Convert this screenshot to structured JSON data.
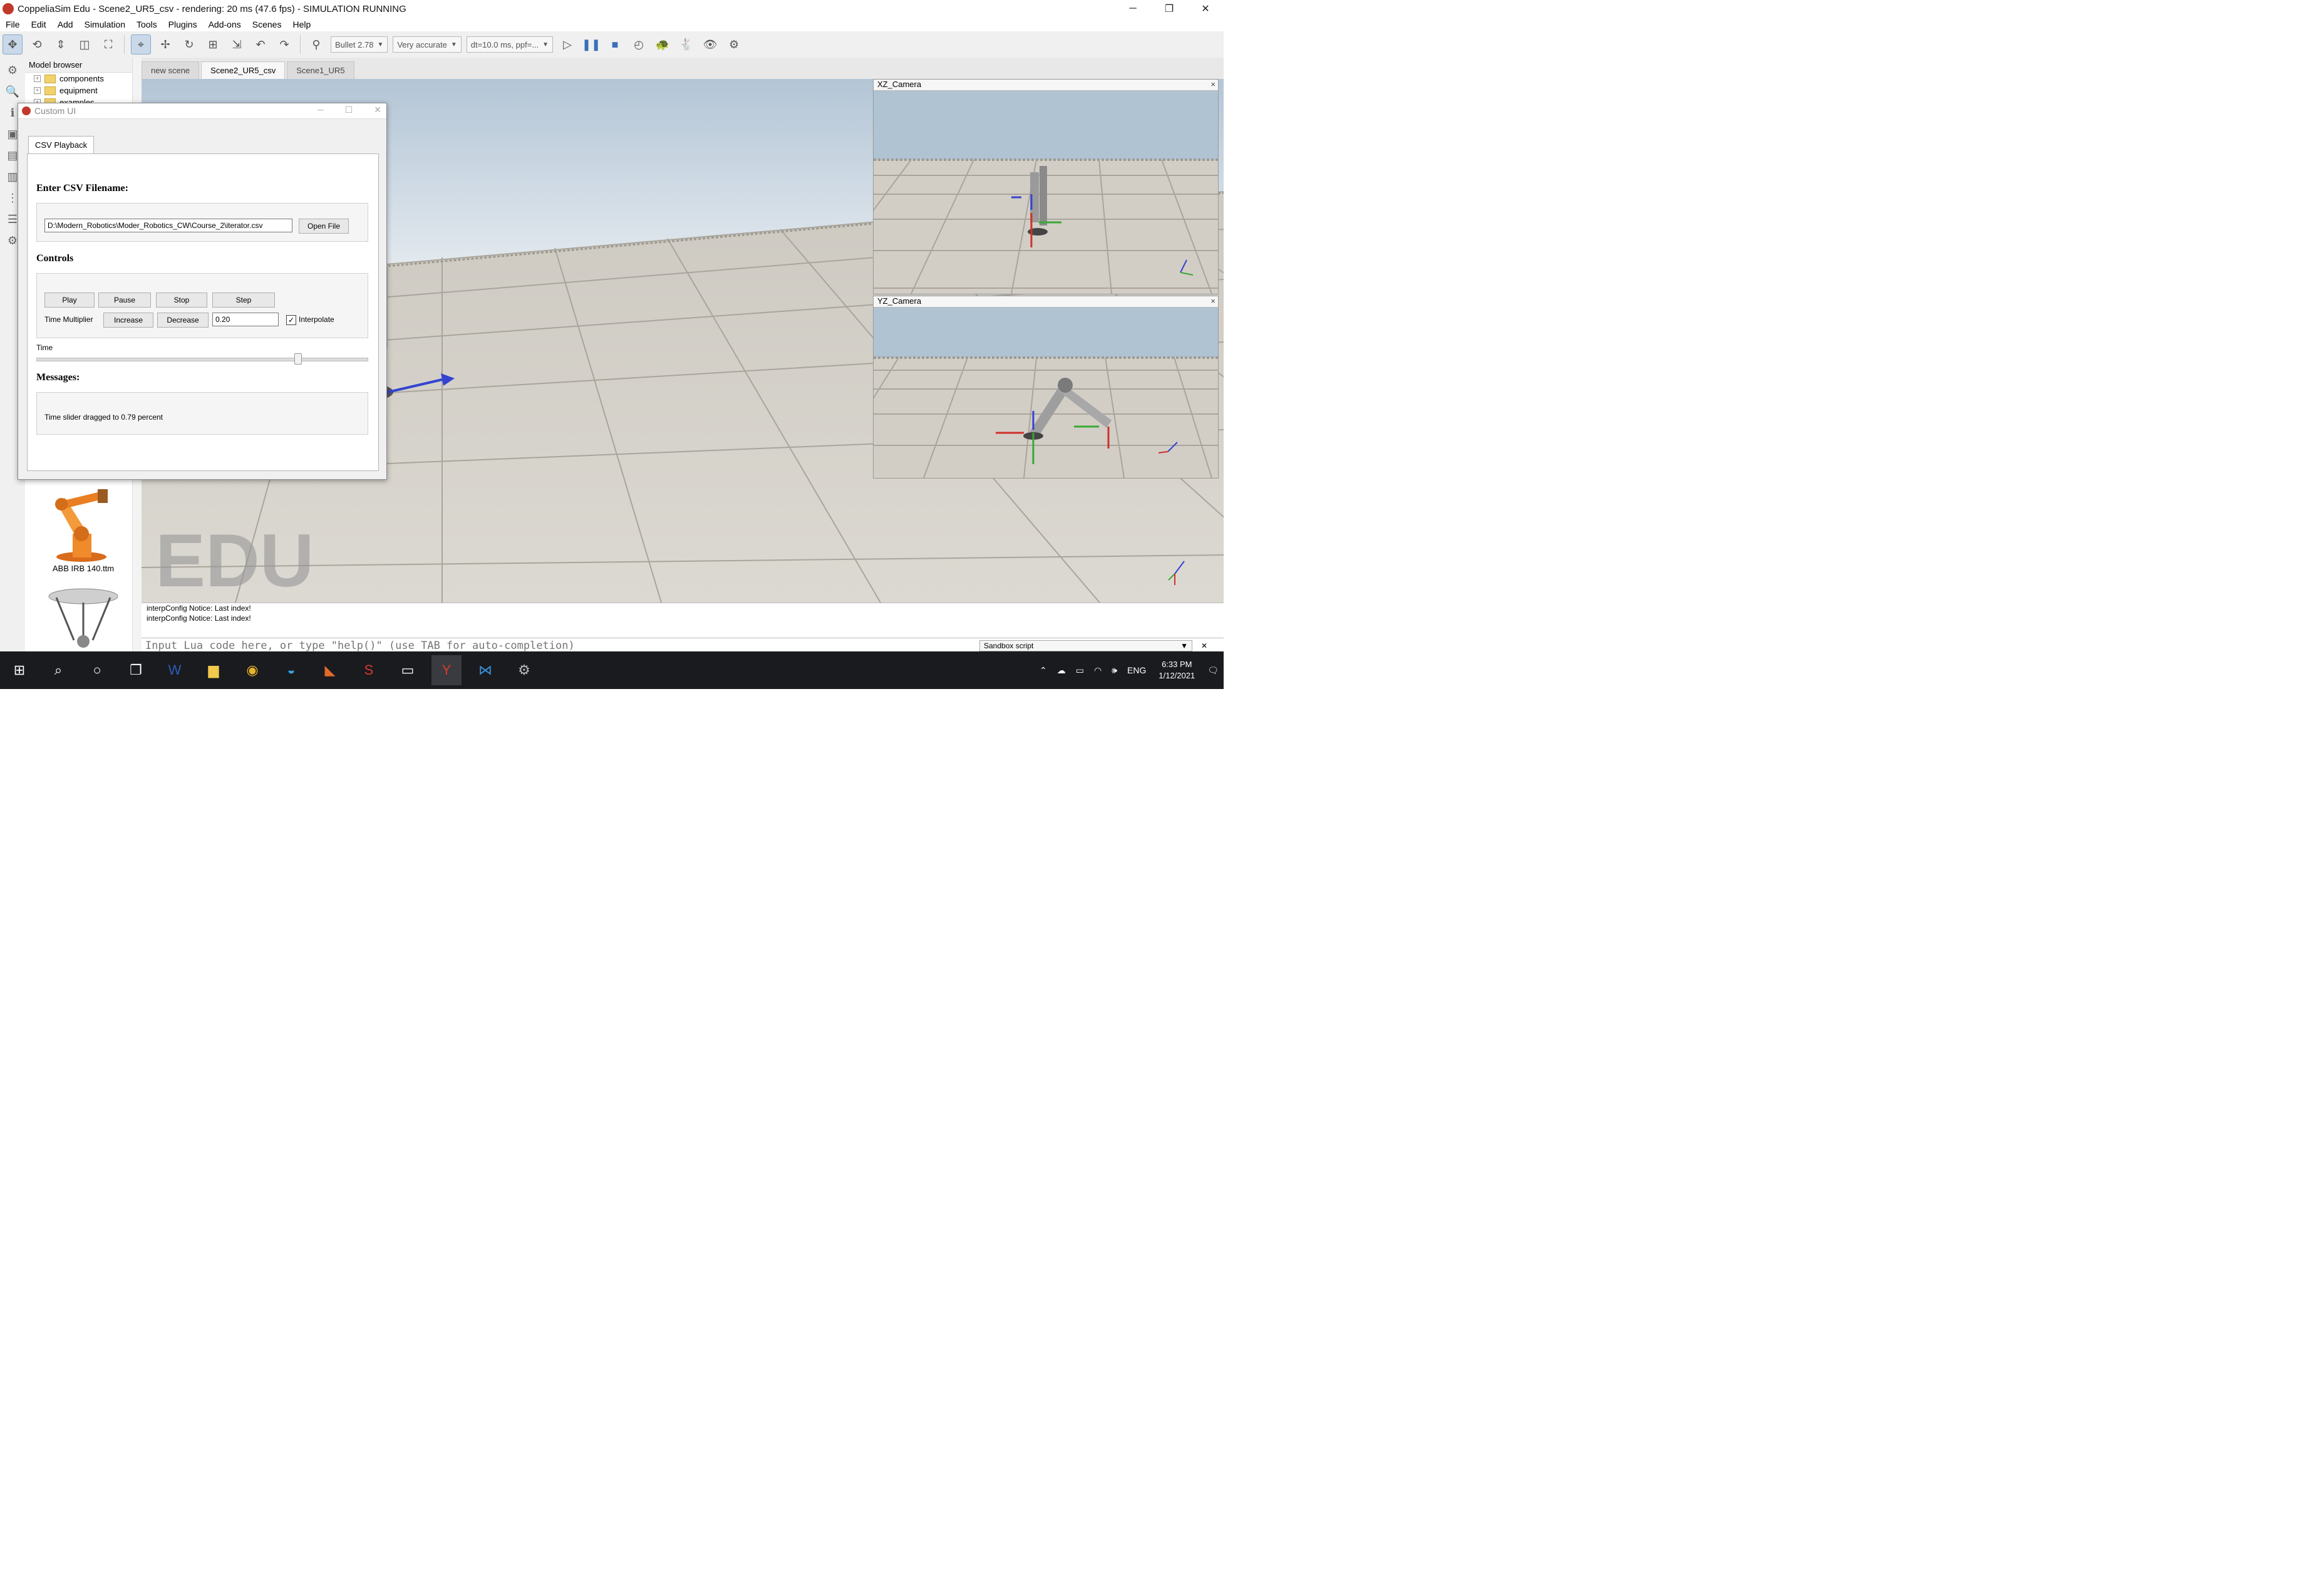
{
  "window": {
    "title": "CoppeliaSim Edu - Scene2_UR5_csv - rendering: 20 ms (47.6 fps) - SIMULATION RUNNING",
    "controls": [
      "─",
      "❐",
      "✕"
    ]
  },
  "menu": [
    "File",
    "Edit",
    "Add",
    "Simulation",
    "Tools",
    "Plugins",
    "Add-ons",
    "Scenes",
    "Help"
  ],
  "toolbar": {
    "engine": "Bullet 2.78",
    "accuracy": "Very accurate",
    "timestep": "dt=10.0 ms, ppf=..."
  },
  "model_browser": {
    "title": "Model browser",
    "items": [
      "components",
      "equipment",
      "examples"
    ],
    "thumbnail_label": "ABB IRB 140.ttm"
  },
  "scene_tabs": [
    "new scene",
    "Scene2_UR5_csv",
    "Scene1_UR5"
  ],
  "viewport": {
    "edu_watermark": "EDU"
  },
  "cameras": [
    {
      "title": "XZ_Camera",
      "close": "×"
    },
    {
      "title": "YZ_Camera",
      "close": "×"
    }
  ],
  "dialog": {
    "title": "Custom UI",
    "tab": "CSV Playback",
    "filename_heading": "Enter CSV Filename:",
    "filename_value": "D:\\Modern_Robotics\\Moder_Robotics_CW\\Course_2\\iterator.csv",
    "open_file": "Open File",
    "controls_heading": "Controls",
    "buttons": {
      "play": "Play",
      "pause": "Pause",
      "stop": "Stop",
      "step": "Step"
    },
    "time_multiplier_label": "Time Multiplier",
    "increase": "Increase",
    "decrease": "Decrease",
    "multiplier_value": "0.20",
    "interpolate_label": "Interpolate",
    "interpolate_checked": true,
    "time_label": "Time",
    "time_slider_fraction": 0.79,
    "messages_heading": "Messages:",
    "message_text": "Time slider dragged to 0.79 percent"
  },
  "console": {
    "lines": [
      "interpConfig Notice: Last index!",
      "interpConfig Notice: Last index!"
    ],
    "input_placeholder": "Input Lua code here, or type \"help()\" (use TAB for auto-completion)",
    "script_select": "Sandbox script",
    "close": "✕"
  },
  "taskbar": {
    "language": "ENG",
    "time": "6:33 PM",
    "date": "1/12/2021"
  },
  "colors": {
    "accent": "#7aa7dc",
    "taskbar": "#1a1b1f",
    "axis_x": "#d0302b",
    "axis_y": "#3aa834",
    "axis_z": "#3444d0"
  }
}
